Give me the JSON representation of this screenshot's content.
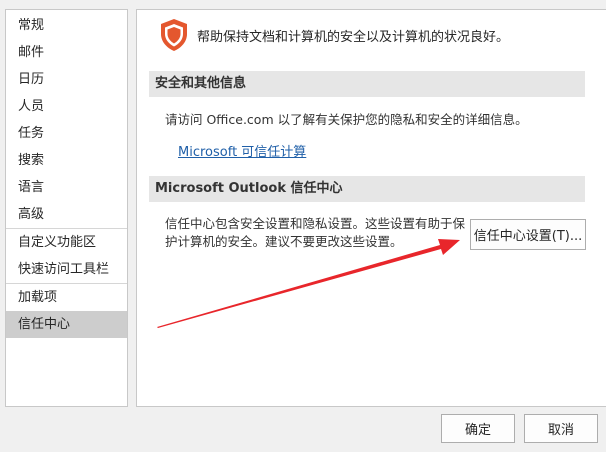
{
  "sidebar": {
    "items": [
      {
        "label": "常规"
      },
      {
        "label": "邮件"
      },
      {
        "label": "日历"
      },
      {
        "label": "人员"
      },
      {
        "label": "任务"
      },
      {
        "label": "搜索"
      },
      {
        "label": "语言"
      },
      {
        "label": "高级"
      },
      {
        "label": "自定义功能区"
      },
      {
        "label": "快速访问工具栏"
      },
      {
        "label": "加载项"
      },
      {
        "label": "信任中心",
        "selected": true
      }
    ]
  },
  "main": {
    "header_text": "帮助保持文档和计算机的安全以及计算机的状况良好。",
    "header_icon": "shield-icon",
    "section1": {
      "title": "安全和其他信息",
      "text": "请访问 Office.com  以了解有关保护您的隐私和安全的详细信息。",
      "link": "Microsoft 可信任计算"
    },
    "section2": {
      "title": "Microsoft Outlook 信任中心",
      "text_line1": "信任中心包含安全设置和隐私设置。这些设置有助于保",
      "text_line2": "护计算机的安全。建议不要更改这些设置。",
      "button": "信任中心设置(T)..."
    }
  },
  "footer": {
    "ok": "确定",
    "cancel": "取消"
  },
  "colors": {
    "accent_shield": "#e4572e",
    "arrow": "#e8262b",
    "selected_bg": "#cdcdcd",
    "link": "#1f5fa8"
  }
}
